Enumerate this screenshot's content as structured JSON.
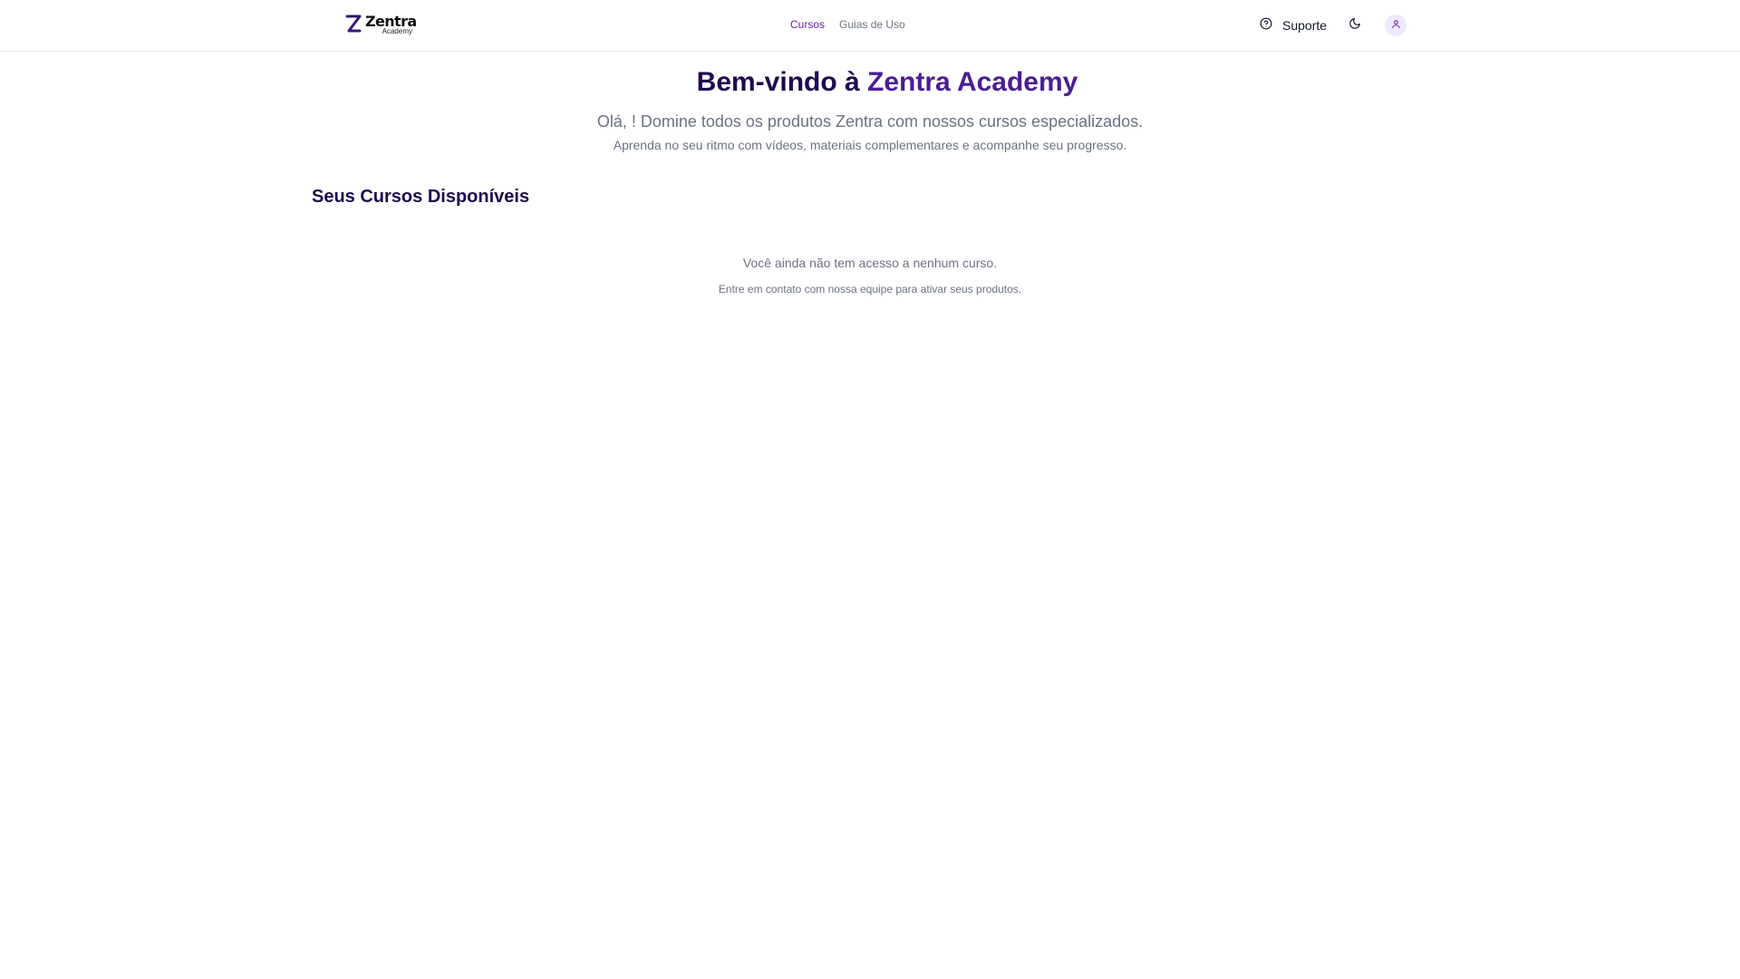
{
  "header": {
    "logo": {
      "word": "Zentra",
      "sub": "Academy"
    },
    "nav": [
      {
        "label": "Cursos",
        "active": true
      },
      {
        "label": "Guias de Uso",
        "active": false
      }
    ],
    "support_label": "Suporte",
    "icons": {
      "support": "help-circle-icon",
      "theme": "moon-icon",
      "avatar": "user-icon"
    }
  },
  "hero": {
    "title_prefix": "Bem-vindo à ",
    "title_brand": "Zentra Academy",
    "subtitle": "Olá, ! Domine todos os produtos Zentra com nossos cursos especializados.",
    "description": "Aprenda no seu ritmo com vídeos, materiais complementares e acompanhe seu progresso."
  },
  "courses": {
    "section_title": "Seus Cursos Disponíveis",
    "empty_message": "Você ainda não tem acesso a nenhum curso.",
    "empty_hint": "Entre em contato com nossa equipe para ativar seus produtos."
  },
  "colors": {
    "accent": "#6b21a8",
    "heading": "#1e0a4f",
    "brand": "#4c1d95",
    "muted": "#6b7280",
    "avatar_bg": "#ede9fe"
  }
}
